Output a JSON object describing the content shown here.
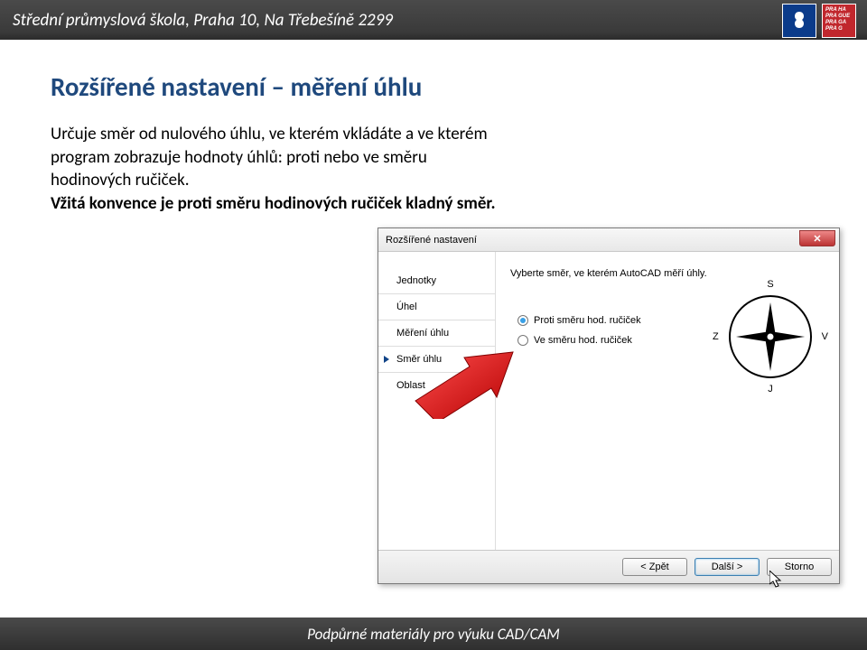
{
  "header": {
    "school": "Střední průmyslová škola, Praha 10, Na Třebešíně 2299",
    "logo_sps": "SPŠ",
    "logo_praha": "PRA HA\nPRA GUE\nPRA GA\nPRA G"
  },
  "title": "Rozšířené nastavení – měření úhlu",
  "body": {
    "p1": "Určuje směr od nulového úhlu, ve kterém vkládáte a ve kterém program zobrazuje hodnoty úhlů: proti nebo ve směru hodinových ručiček.",
    "p2": "Vžitá konvence je proti směru hodinových ručiček kladný směr."
  },
  "dialog": {
    "title": "Rozšířené nastavení",
    "instruction": "Vyberte směr, ve kterém AutoCAD měří úhly.",
    "sidebar": {
      "items": [
        "Jednotky",
        "Úhel",
        "Měření úhlu",
        "Směr úhlu",
        "Oblast"
      ],
      "selected_index": 3
    },
    "radios": {
      "r0": "Proti směru hod. ručiček",
      "r1": "Ve směru hod. ručiček",
      "selected": 0
    },
    "compass_labels": {
      "n": "S",
      "s": "J",
      "w": "Z",
      "e": "V"
    },
    "buttons": {
      "back": "< Zpět",
      "next": "Další >",
      "cancel": "Storno"
    }
  },
  "footer": "Podpůrné materiály pro výuku CAD/CAM"
}
